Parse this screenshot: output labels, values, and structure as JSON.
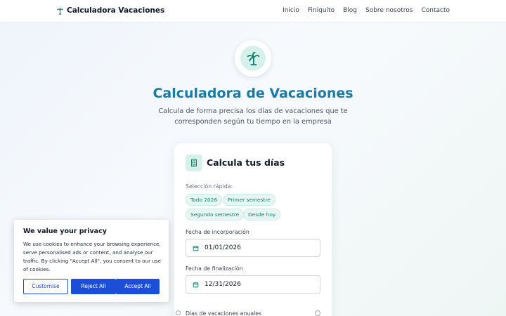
{
  "header": {
    "brand": "Calculadora Vacaciones",
    "nav": [
      "Inicio",
      "Finiquito",
      "Blog",
      "Sobre nosotros",
      "Contacto"
    ]
  },
  "hero": {
    "icon": "palm-tree-icon",
    "title": "Calculadora de Vacaciones",
    "subtitle": "Calcula de forma precisa los días de vacaciones que te corresponden según tu tiempo en la empresa"
  },
  "card": {
    "icon": "calculator-icon",
    "title": "Calcula tus días",
    "quick_label": "Selección rápida:",
    "chips": [
      "Todo 2026",
      "Primer semestre",
      "Segundo semestre",
      "Desde hoy"
    ],
    "start_label": "Fecha de incorporación",
    "start_value": "01/01/2026",
    "end_label": "Fecha de finalización",
    "end_value": "12/31/2026",
    "annual_label": "Días de vacaciones anuales"
  },
  "cookie": {
    "title": "We value your privacy",
    "text": "We use cookies to enhance your browsing experience, serve personalised ads or content, and analyse our traffic. By clicking \"Accept All\", you consent to our use of cookies.",
    "customise": "Customise",
    "reject": "Reject All",
    "accept": "Accept All"
  },
  "colors": {
    "accent": "#1a7ba5",
    "teal": "#12806a",
    "button_blue": "#1d4ed8"
  }
}
